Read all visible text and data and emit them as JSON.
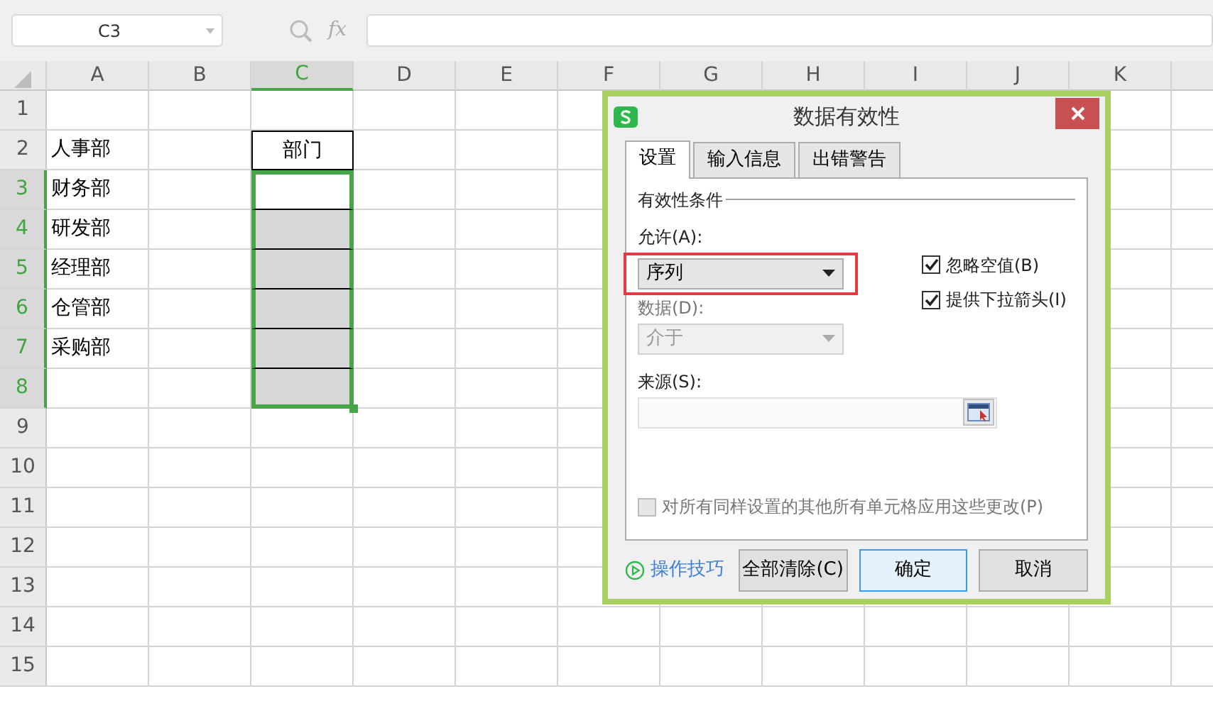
{
  "name_box": {
    "value": "C3"
  },
  "formula_bar": {
    "fx": "fx"
  },
  "sheet": {
    "columns": [
      {
        "label": "A",
        "selected": false
      },
      {
        "label": "B",
        "selected": false
      },
      {
        "label": "C",
        "selected": true
      },
      {
        "label": "D",
        "selected": false
      },
      {
        "label": "E",
        "selected": false
      },
      {
        "label": "F",
        "selected": false
      },
      {
        "label": "G",
        "selected": false
      },
      {
        "label": "H",
        "selected": false
      },
      {
        "label": "I",
        "selected": false
      },
      {
        "label": "J",
        "selected": false
      },
      {
        "label": "K",
        "selected": false
      }
    ],
    "rows": [
      {
        "label": "1",
        "selected": false
      },
      {
        "label": "2",
        "selected": false,
        "active": false,
        "bordered": true,
        "column_a": "人事部",
        "column_c": "部门"
      },
      {
        "label": "3",
        "selected": true,
        "active": true,
        "bordered": true,
        "column_a": "财务部"
      },
      {
        "label": "4",
        "selected": true,
        "active": false,
        "bordered": true,
        "column_a": "研发部"
      },
      {
        "label": "5",
        "selected": true,
        "active": false,
        "bordered": true,
        "column_a": "经理部"
      },
      {
        "label": "6",
        "selected": true,
        "active": false,
        "bordered": true,
        "column_a": "仓管部"
      },
      {
        "label": "7",
        "selected": true,
        "active": false,
        "bordered": true,
        "column_a": "采购部"
      },
      {
        "label": "8",
        "selected": true,
        "active": false,
        "bordered": true
      },
      {
        "label": "9",
        "selected": false
      },
      {
        "label": "10",
        "selected": false
      },
      {
        "label": "11",
        "selected": false
      },
      {
        "label": "12",
        "selected": false
      },
      {
        "label": "13",
        "selected": false
      },
      {
        "label": "14",
        "selected": false
      },
      {
        "label": "15",
        "selected": false
      }
    ]
  },
  "dialog": {
    "title": "数据有效性",
    "tabs": [
      {
        "label": "设置",
        "selected": true
      },
      {
        "label": "输入信息",
        "selected": false
      },
      {
        "label": "出错警告",
        "selected": false
      }
    ],
    "section": "有效性条件",
    "allow": {
      "label": "允许(A):",
      "value": "序列",
      "highlighted": true,
      "disabled": false
    },
    "data": {
      "label": "数据(D):",
      "value": "介于",
      "disabled": true
    },
    "checkboxes": [
      {
        "label": "忽略空值(B)",
        "checked": true
      },
      {
        "label": "提供下拉箭头(I)",
        "checked": true
      }
    ],
    "source": {
      "label": "来源(S):"
    },
    "apply_all": {
      "label": "对所有同样设置的其他所有单元格应用这些更改(P)",
      "checked": false,
      "disabled": true
    },
    "tips_link": "操作技巧",
    "buttons": [
      {
        "label": "全部清除(C)",
        "default": false
      },
      {
        "label": "确定",
        "default": true
      },
      {
        "label": "取消",
        "default": false
      }
    ]
  }
}
